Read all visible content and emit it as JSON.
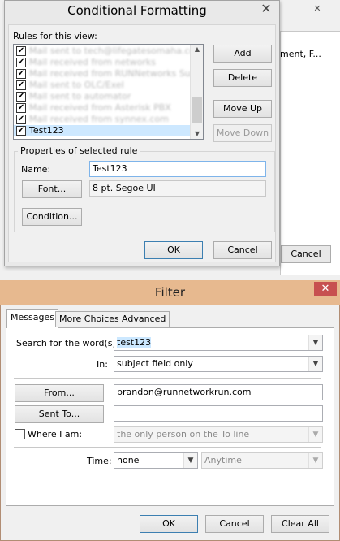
{
  "background": {
    "right_text": "ment, F...",
    "cancel_label": "Cancel",
    "close_glyph": "✕"
  },
  "conditional_formatting": {
    "title": "Conditional Formatting",
    "close_glyph": "✕",
    "rules_label": "Rules for this view:",
    "rules": [
      {
        "label": "Mail sent to tech@lifegatesomaha.com",
        "checked": true,
        "selected": false
      },
      {
        "label": "Mail received from networks",
        "checked": true,
        "selected": false
      },
      {
        "label": "Mail received from RUNNetworks Support",
        "checked": true,
        "selected": false
      },
      {
        "label": "Mail sent to OLC/Exel",
        "checked": true,
        "selected": false
      },
      {
        "label": "Mail sent to automator",
        "checked": true,
        "selected": false
      },
      {
        "label": "Mail received from Asterisk PBX",
        "checked": true,
        "selected": false
      },
      {
        "label": "Mail received from synnex.com",
        "checked": true,
        "selected": false
      },
      {
        "label": "Test123",
        "checked": true,
        "selected": true
      }
    ],
    "buttons": {
      "add": "Add",
      "delete": "Delete",
      "move_up": "Move Up",
      "move_down": "Move Down",
      "ok": "OK",
      "cancel": "Cancel"
    },
    "properties_label": "Properties of selected rule",
    "name_label": "Name:",
    "name_value": "Test123",
    "font_button": "Font...",
    "font_value": "8 pt. Segoe UI",
    "condition_button": "Condition..."
  },
  "filter": {
    "title": "Filter",
    "close_glyph": "✕",
    "tabs": [
      {
        "label": "Messages",
        "active": true
      },
      {
        "label": "More Choices",
        "active": false
      },
      {
        "label": "Advanced",
        "active": false
      }
    ],
    "search_label": "Search for the word(s):",
    "search_value": "test123",
    "in_label": "In:",
    "in_value": "subject field only",
    "from_button": "From...",
    "from_value": "brandon@runnetworkrun.com",
    "sent_to_button": "Sent To...",
    "sent_to_value": "",
    "where_i_am_label": "Where I am:",
    "where_i_am_value": "the only person on the To line",
    "time_label": "Time:",
    "time_value": "none",
    "time_range_value": "Anytime",
    "buttons": {
      "ok": "OK",
      "cancel": "Cancel",
      "clear_all": "Clear All"
    }
  }
}
